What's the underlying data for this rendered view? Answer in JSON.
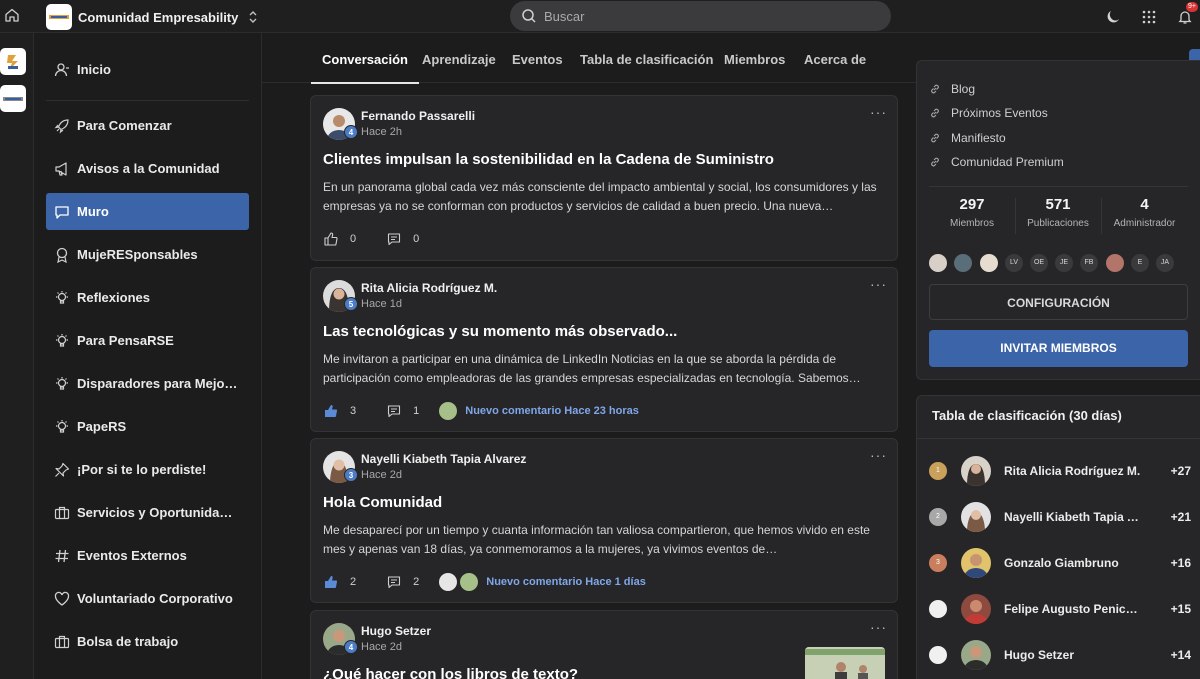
{
  "topbar": {
    "community_name": "Comunidad Empresability",
    "search_placeholder": "Buscar",
    "notification_count": "9+"
  },
  "nav": {
    "items": [
      {
        "label": "Inicio",
        "icon": "user-icon"
      },
      {
        "label": "Para Comenzar",
        "icon": "rocket-icon"
      },
      {
        "label": "Avisos a la Comunidad",
        "icon": "megaphone-icon"
      },
      {
        "label": "Muro",
        "icon": "chat-bubble-icon",
        "active": true
      },
      {
        "label": "MujeRESponsables",
        "icon": "badge-icon"
      },
      {
        "label": "Reflexiones",
        "icon": "lightbulb-icon"
      },
      {
        "label": "Para PensaRSE",
        "icon": "lightbulb-icon"
      },
      {
        "label": "Disparadores para Mejo…",
        "icon": "lightbulb-icon"
      },
      {
        "label": "PapeRS",
        "icon": "lightbulb-icon"
      },
      {
        "label": "¡Por si te lo perdiste!",
        "icon": "pin-icon"
      },
      {
        "label": "Servicios y Oportunida…",
        "icon": "briefcase-icon"
      },
      {
        "label": "Eventos Externos",
        "icon": "hash-icon"
      },
      {
        "label": "Voluntariado Corporativo",
        "icon": "heart-icon"
      },
      {
        "label": "Bolsa de trabajo",
        "icon": "briefcase-icon"
      }
    ]
  },
  "tabs": [
    "Conversación",
    "Aprendizaje",
    "Eventos",
    "Tabla de clasificación",
    "Miembros",
    "Acerca de"
  ],
  "posts": [
    {
      "author": "Fernando Passarelli",
      "level": "4",
      "time": "Hace 2h",
      "title": "Clientes impulsan la sostenibilidad en la Cadena de Suministro",
      "excerpt": "En un panorama global cada vez más consciente del impacto ambiental y social, los consumidores y las empresas ya no se conforman con productos y servicios de calidad a buen precio. Una nueva…",
      "likes": "0",
      "comments": "0",
      "new_comment": ""
    },
    {
      "author": "Rita Alicia Rodríguez M.",
      "level": "5",
      "time": "Hace 1d",
      "title": "Las tecnológicas y su momento más observado...",
      "excerpt": "Me invitaron a participar en una dinámica de LinkedIn Noticias en la que se aborda la pérdida de participación como empleadoras de las grandes empresas especializadas en tecnología. Sabemos…",
      "likes": "3",
      "comments": "1",
      "new_comment": "Nuevo comentario Hace 23 horas"
    },
    {
      "author": "Nayelli Kiabeth Tapia Alvarez",
      "level": "3",
      "time": "Hace 2d",
      "title": "Hola Comunidad",
      "excerpt": "Me desaparecí por un tiempo y cuanta información tan valiosa compartieron, que hemos vivido en este mes y apenas van 18 días, ya conmemoramos a la mujeres, ya vivimos eventos de…",
      "likes": "2",
      "comments": "2",
      "new_comment": "Nuevo comentario Hace 1 días"
    },
    {
      "author": "Hugo Setzer",
      "level": "4",
      "time": "Hace 2d",
      "title": "¿Qué hacer con los libros de texto?"
    }
  ],
  "side": {
    "links": [
      "Blog",
      "Próximos Eventos",
      "Manifiesto",
      "Comunidad Premium"
    ],
    "stats": [
      {
        "num": "297",
        "cap": "Miembros"
      },
      {
        "num": "571",
        "cap": "Publicaciones"
      },
      {
        "num": "4",
        "cap": "Administrador"
      }
    ],
    "member_initials": [
      "LV",
      "OE",
      "JE",
      "FB",
      "E",
      "JA"
    ],
    "config_label": "CONFIGURACIÓN",
    "invite_label": "INVITAR MIEMBROS"
  },
  "leaderboard": {
    "title": "Tabla de clasificación (30 días)",
    "rows": [
      {
        "rank": "1",
        "name": "Rita Alicia Rodríguez M.",
        "score": "+27",
        "medal_color": "#c9a15a"
      },
      {
        "rank": "2",
        "name": "Nayelli Kiabeth Tapia Alv…",
        "score": "+21",
        "medal_color": "#a8a8a8"
      },
      {
        "rank": "3",
        "name": "Gonzalo Giambruno",
        "score": "+16",
        "medal_color": "#c97f5e"
      },
      {
        "rank": "",
        "name": "Felipe Augusto Peniche …",
        "score": "+15",
        "medal_color": "#f0f0f0"
      },
      {
        "rank": "",
        "name": "Hugo Setzer",
        "score": "+14",
        "medal_color": "#f0f0f0"
      }
    ]
  },
  "colors": {
    "accent": "#3c64a8",
    "link": "#7fa7e8",
    "background": "#1c1c1d",
    "card": "#262628"
  }
}
